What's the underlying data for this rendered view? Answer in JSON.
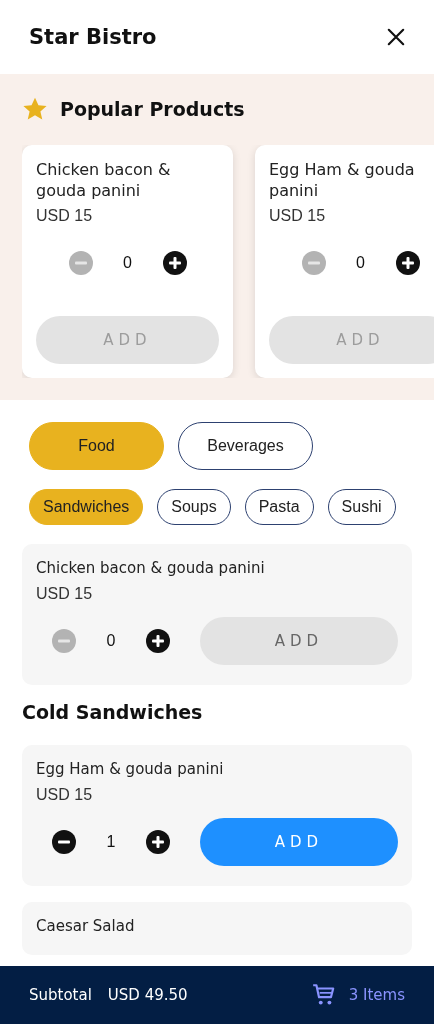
{
  "header": {
    "title": "Star Bistro"
  },
  "popular": {
    "title": "Popular Products",
    "items": [
      {
        "name": "Chicken bacon & gouda panini",
        "price": "USD 15",
        "quantity": "0",
        "decrease_disabled": true,
        "add_disabled": true,
        "add_label": "ADD"
      },
      {
        "name": "Egg Ham & gouda panini",
        "price": "USD 15",
        "quantity": "0",
        "decrease_disabled": true,
        "add_disabled": true,
        "add_label": "ADD"
      }
    ]
  },
  "menu_tabs": [
    {
      "label": "Food",
      "selected": true
    },
    {
      "label": "Beverages",
      "selected": false
    }
  ],
  "category_chips": [
    {
      "label": "Sandwiches",
      "selected": true
    },
    {
      "label": "Soups",
      "selected": false
    },
    {
      "label": "Pasta",
      "selected": false
    },
    {
      "label": "Sushi",
      "selected": false
    }
  ],
  "sections": [
    {
      "items": [
        {
          "name": "Chicken bacon & gouda panini",
          "price": "USD 15",
          "quantity": "0",
          "decrease_disabled": true,
          "add_disabled": true,
          "add_label": "ADD"
        }
      ]
    },
    {
      "title": "Cold Sandwiches",
      "items": [
        {
          "name": "Egg Ham & gouda panini",
          "price": "USD 15",
          "quantity": "1",
          "decrease_disabled": false,
          "add_disabled": false,
          "add_label": "ADD"
        },
        {
          "name": "Caesar Salad"
        }
      ]
    }
  ],
  "cart_bar": {
    "subtotal_label": "Subtotal",
    "subtotal": "USD 49.50",
    "items": "3 Items"
  }
}
